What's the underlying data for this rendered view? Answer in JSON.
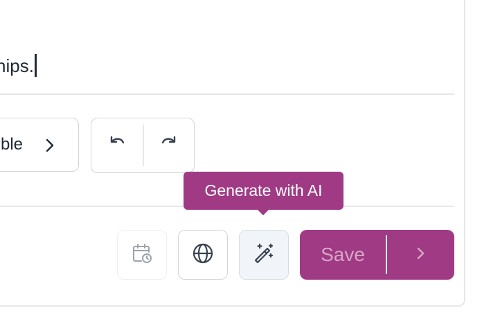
{
  "editor": {
    "text": "hips."
  },
  "toolbar": {
    "chip_label": "ble",
    "undo_icon": "undo-icon",
    "redo_icon": "redo-icon"
  },
  "tooltip": {
    "text": "Generate with AI"
  },
  "actions": {
    "schedule_icon": "calendar-clock-icon",
    "language_icon": "globe-icon",
    "ai_icon": "magic-wand-icon",
    "save_label": "Save"
  },
  "colors": {
    "brand": "#a03a85",
    "save_text_disabled": "#d6a7c7",
    "icon": "#374151",
    "icon_disabled": "#9ca3af",
    "border": "#d1d5db"
  }
}
